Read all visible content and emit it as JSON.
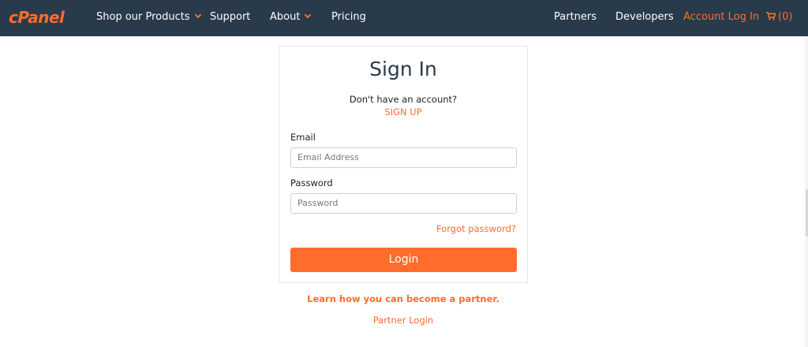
{
  "nav": {
    "logo": "cPanel",
    "items": [
      {
        "label": "Shop our Products"
      },
      {
        "label": "Support"
      },
      {
        "label": "About"
      },
      {
        "label": "Pricing"
      },
      {
        "label": "Partners"
      },
      {
        "label": "Developers"
      },
      {
        "label": "Account Log In"
      }
    ],
    "cart_count": "(0)"
  },
  "signin": {
    "title": "Sign In",
    "no_account": "Don't have an account?",
    "signup": "SIGN UP",
    "email_label": "Email",
    "email_placeholder": "Email Address",
    "password_label": "Password",
    "password_placeholder": "Password",
    "forgot": "Forgot password?",
    "login": "Login"
  },
  "partner": {
    "learn": "Learn how you can become a partner.",
    "login": "Partner Login"
  },
  "colors": {
    "nav_bg": "#293a4a",
    "accent": "#ff6c2c"
  },
  "icons": {
    "cart": "cart-icon",
    "dropdown": "chevron-down-icon"
  }
}
